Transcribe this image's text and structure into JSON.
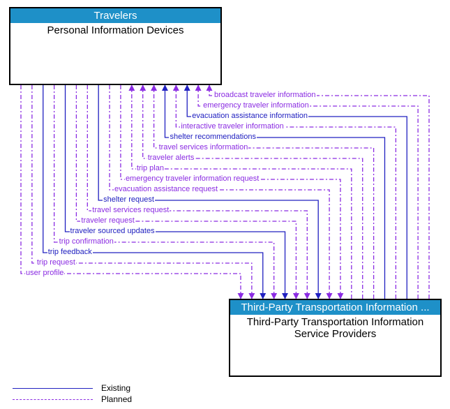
{
  "boxes": {
    "top": {
      "header": "Travelers",
      "body": "Personal Information Devices",
      "header_color": "#1e90c8"
    },
    "bottom": {
      "header": "Third-Party Transportation Information ...",
      "body": "Third-Party Transportation Information Service Providers",
      "header_color": "#1e90c8"
    }
  },
  "colors": {
    "existing": "#2020c0",
    "planned": "#8a2be2"
  },
  "legend": {
    "existing": "Existing",
    "planned": "Planned"
  },
  "flows": [
    {
      "label": "user profile",
      "style": "planned",
      "direction": "down"
    },
    {
      "label": "trip request",
      "style": "planned",
      "direction": "down"
    },
    {
      "label": "trip feedback",
      "style": "existing",
      "direction": "down"
    },
    {
      "label": "trip confirmation",
      "style": "planned",
      "direction": "down"
    },
    {
      "label": "traveler sourced updates",
      "style": "existing",
      "direction": "down"
    },
    {
      "label": "traveler request",
      "style": "planned",
      "direction": "down"
    },
    {
      "label": "travel services request",
      "style": "planned",
      "direction": "down"
    },
    {
      "label": "shelter request",
      "style": "existing",
      "direction": "down"
    },
    {
      "label": "evacuation assistance request",
      "style": "planned",
      "direction": "down"
    },
    {
      "label": "emergency traveler information request",
      "style": "planned",
      "direction": "down"
    },
    {
      "label": "trip plan",
      "style": "planned",
      "direction": "up"
    },
    {
      "label": "traveler alerts",
      "style": "planned",
      "direction": "up"
    },
    {
      "label": "travel services information",
      "style": "planned",
      "direction": "up"
    },
    {
      "label": "shelter recommendations",
      "style": "existing",
      "direction": "up"
    },
    {
      "label": "interactive traveler information",
      "style": "planned",
      "direction": "up"
    },
    {
      "label": "evacuation assistance information",
      "style": "existing",
      "direction": "up"
    },
    {
      "label": "emergency traveler information",
      "style": "planned",
      "direction": "up"
    },
    {
      "label": "broadcast traveler information",
      "style": "planned",
      "direction": "up"
    }
  ],
  "chart_data": {
    "type": "diagram",
    "nodes": [
      {
        "id": "pid",
        "group": "Travelers",
        "label": "Personal Information Devices"
      },
      {
        "id": "tpt",
        "group": "Third-Party Transportation Information",
        "label": "Third-Party Transportation Information Service Providers"
      }
    ],
    "edges": [
      {
        "from": "pid",
        "to": "tpt",
        "label": "user profile",
        "status": "planned"
      },
      {
        "from": "pid",
        "to": "tpt",
        "label": "trip request",
        "status": "planned"
      },
      {
        "from": "pid",
        "to": "tpt",
        "label": "trip feedback",
        "status": "existing"
      },
      {
        "from": "pid",
        "to": "tpt",
        "label": "trip confirmation",
        "status": "planned"
      },
      {
        "from": "pid",
        "to": "tpt",
        "label": "traveler sourced updates",
        "status": "existing"
      },
      {
        "from": "pid",
        "to": "tpt",
        "label": "traveler request",
        "status": "planned"
      },
      {
        "from": "pid",
        "to": "tpt",
        "label": "travel services request",
        "status": "planned"
      },
      {
        "from": "pid",
        "to": "tpt",
        "label": "shelter request",
        "status": "existing"
      },
      {
        "from": "pid",
        "to": "tpt",
        "label": "evacuation assistance request",
        "status": "planned"
      },
      {
        "from": "pid",
        "to": "tpt",
        "label": "emergency traveler information request",
        "status": "planned"
      },
      {
        "from": "tpt",
        "to": "pid",
        "label": "trip plan",
        "status": "planned"
      },
      {
        "from": "tpt",
        "to": "pid",
        "label": "traveler alerts",
        "status": "planned"
      },
      {
        "from": "tpt",
        "to": "pid",
        "label": "travel services information",
        "status": "planned"
      },
      {
        "from": "tpt",
        "to": "pid",
        "label": "shelter recommendations",
        "status": "existing"
      },
      {
        "from": "tpt",
        "to": "pid",
        "label": "interactive traveler information",
        "status": "planned"
      },
      {
        "from": "tpt",
        "to": "pid",
        "label": "evacuation assistance information",
        "status": "existing"
      },
      {
        "from": "tpt",
        "to": "pid",
        "label": "emergency traveler information",
        "status": "planned"
      },
      {
        "from": "tpt",
        "to": "pid",
        "label": "broadcast traveler information",
        "status": "planned"
      }
    ],
    "legend": {
      "existing": "solid blue",
      "planned": "dashed purple"
    }
  }
}
